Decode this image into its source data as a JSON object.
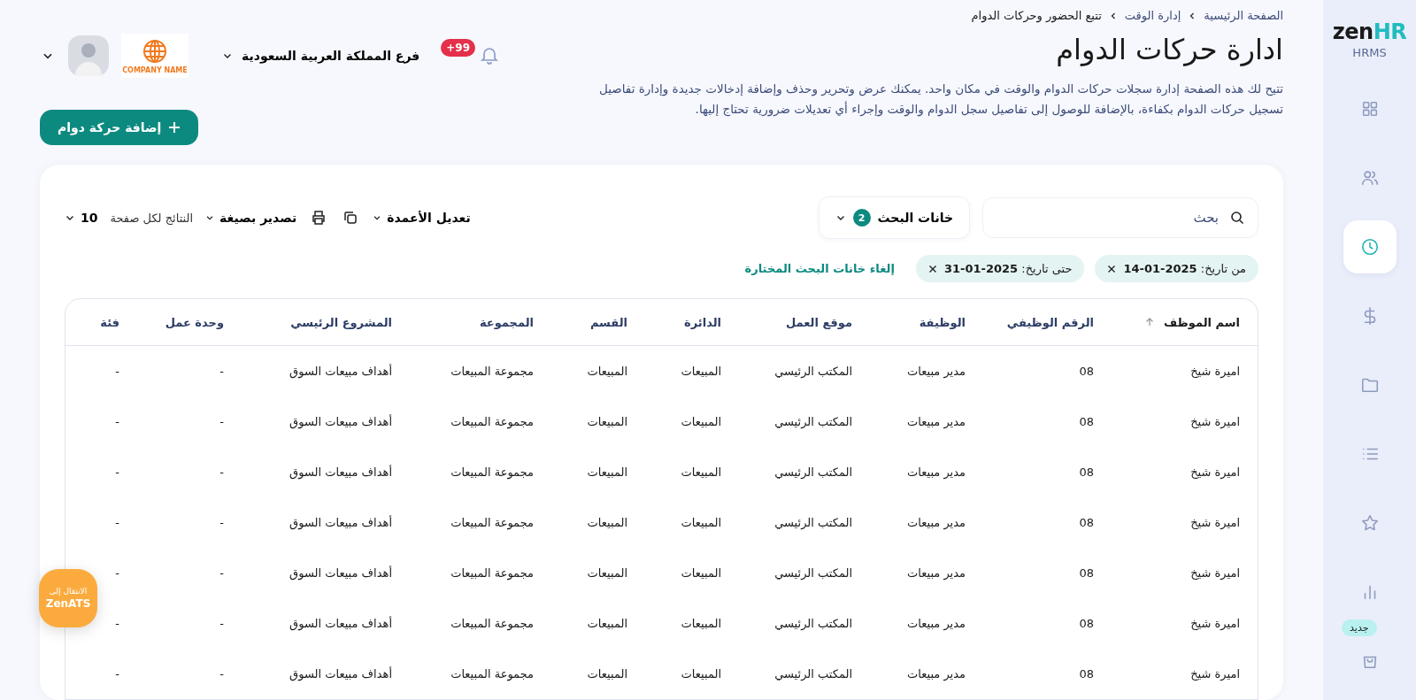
{
  "sidebar": {
    "logo_main": "zen",
    "logo_accent": "HR",
    "subtitle": "HRMS",
    "items": [
      {
        "selected": false
      },
      {
        "selected": false
      },
      {
        "selected": true
      },
      {
        "selected": false
      },
      {
        "selected": false
      },
      {
        "selected": false
      },
      {
        "selected": false
      },
      {
        "selected": false
      },
      {
        "selected": false,
        "badge": "جديد"
      }
    ]
  },
  "breadcrumb": [
    "الصفحة الرئيسية",
    "إدارة الوقت",
    "تتبع الحضور وحركات الدوام"
  ],
  "title": "ادارة حركات الدوام",
  "description": "تتيح لك هذه الصفحة إدارة سجلات حركات الدوام والوقت في مكان واحد. يمكنك عرض وتحرير وحذف وإضافة إدخالات جديدة وإدارة تفاصيل تسجيل حركات الدوام بكفاءة، بالإضافة للوصول إلى تفاصيل سجل الدوام والوقت وإجراء أي تعديلات ضرورية تحتاج إليها.",
  "topbar": {
    "notifications": "+99",
    "branch": "فرع المملكة العربية السعودية",
    "company_logo": "COMPANY NAME"
  },
  "add_button": "إضافة حركة دوام",
  "search": {
    "placeholder": "بحث"
  },
  "search_fields": {
    "label": "خانات البحث",
    "count": "2"
  },
  "toolbar": {
    "edit_columns": "تعديل الأعمدة",
    "export": "تصدير بصيغة",
    "per_page_label": "النتائج لكل صفحة",
    "per_page": "10"
  },
  "filters": [
    {
      "text": "من تاريخ: **2025-01-14**"
    },
    {
      "text": "حتى تاريخ: **2025-01-31**"
    }
  ],
  "clear_filters": "إلغاء خانات البحث المختارة",
  "table": {
    "columns": [
      {
        "label": "اسم الموظف",
        "sorted": true
      },
      {
        "label": "الرقم الوظيفي",
        "sorted": false
      },
      {
        "label": "الوظيفة",
        "sorted": false
      },
      {
        "label": "موقع العمل",
        "sorted": false
      },
      {
        "label": "الدائرة",
        "sorted": false
      },
      {
        "label": "القسم",
        "sorted": false
      },
      {
        "label": "المجموعة",
        "sorted": false
      },
      {
        "label": "المشروع الرئيسي",
        "sorted": false
      },
      {
        "label": "وحدة عمل",
        "sorted": false
      },
      {
        "label": "فئة",
        "sorted": false
      }
    ],
    "rows": [
      [
        "اميرة شيخ",
        "08",
        "مدير مبيعات",
        "المكتب الرئيسي",
        "المبيعات",
        "المبيعات",
        "مجموعة المبيعات",
        "أهداف مبيعات السوق",
        "-",
        "-"
      ],
      [
        "اميرة شيخ",
        "08",
        "مدير مبيعات",
        "المكتب الرئيسي",
        "المبيعات",
        "المبيعات",
        "مجموعة المبيعات",
        "أهداف مبيعات السوق",
        "-",
        "-"
      ],
      [
        "اميرة شيخ",
        "08",
        "مدير مبيعات",
        "المكتب الرئيسي",
        "المبيعات",
        "المبيعات",
        "مجموعة المبيعات",
        "أهداف مبيعات السوق",
        "-",
        "-"
      ],
      [
        "اميرة شيخ",
        "08",
        "مدير مبيعات",
        "المكتب الرئيسي",
        "المبيعات",
        "المبيعات",
        "مجموعة المبيعات",
        "أهداف مبيعات السوق",
        "-",
        "-"
      ],
      [
        "اميرة شيخ",
        "08",
        "مدير مبيعات",
        "المكتب الرئيسي",
        "المبيعات",
        "المبيعات",
        "مجموعة المبيعات",
        "أهداف مبيعات السوق",
        "-",
        "-"
      ],
      [
        "اميرة شيخ",
        "08",
        "مدير مبيعات",
        "المكتب الرئيسي",
        "المبيعات",
        "المبيعات",
        "مجموعة المبيعات",
        "أهداف مبيعات السوق",
        "-",
        "-"
      ],
      [
        "اميرة شيخ",
        "08",
        "مدير مبيعات",
        "المكتب الرئيسي",
        "المبيعات",
        "المبيعات",
        "مجموعة المبيعات",
        "أهداف مبيعات السوق",
        "-",
        "-"
      ]
    ]
  },
  "floating_button": {
    "line1": "الانتقال إلى",
    "line2": "ZenATS"
  }
}
